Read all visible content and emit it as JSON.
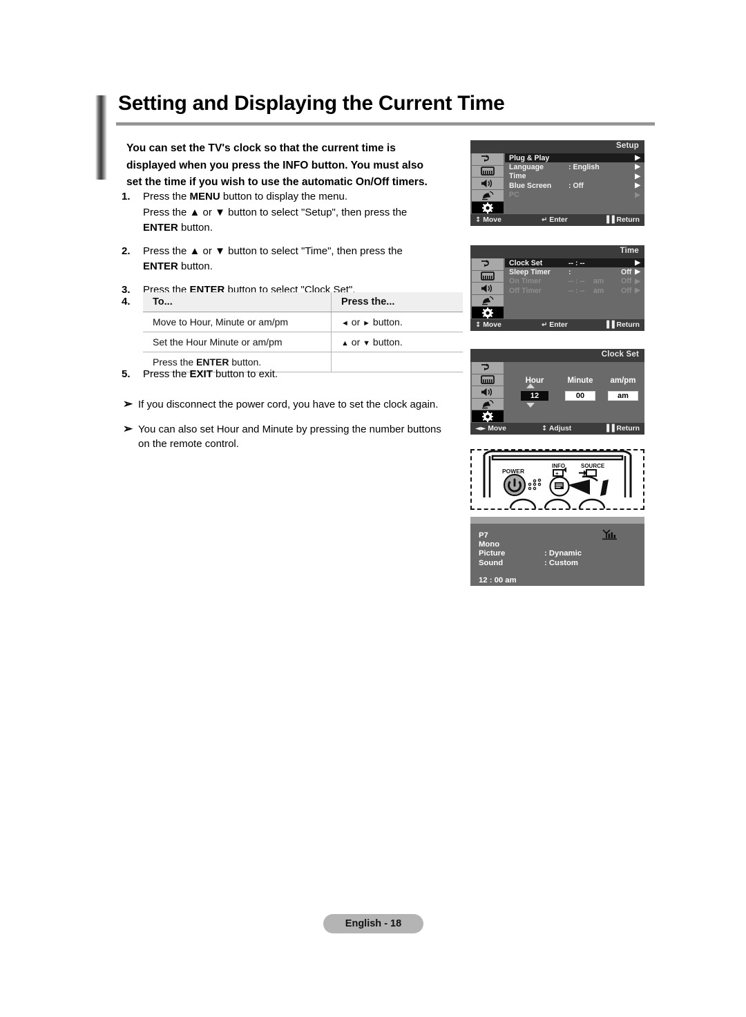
{
  "document": {
    "title": "Setting and Displaying the Current Time",
    "footer_label": "English - 18"
  },
  "intro": {
    "paragraph": "You can set the TV's clock so that the current time is displayed when you press the INFO button. You must also set the time if you wish to use the automatic On/Off timers."
  },
  "steps": [
    {
      "number": "1.",
      "line1_a": "Press the ",
      "line1_b": "MENU",
      "line1_c": " button to display the menu.",
      "line2_a": "Press the ",
      "line2_b": "▲",
      "line2_c": " or ",
      "line2_d": "▼",
      "line2_e": " button to select \"Setup\", then press the",
      "line3_b": "ENTER",
      "line3_c": " button."
    },
    {
      "number": "2.",
      "line1_a": "Press the ",
      "line1_b": "▲",
      "line1_c": " or ",
      "line1_d": "▼",
      "line1_e": " button to select \"Time\", then press the",
      "line2_b": "ENTER",
      "line2_c": " button."
    },
    {
      "number": "3.",
      "line1_a": "Press the ",
      "line1_b": "ENTER",
      "line1_c": " button to select \"Clock Set\"."
    }
  ],
  "table": {
    "step_number": "4.",
    "headers": [
      "To...",
      "Press the..."
    ],
    "rows": [
      {
        "to": "Move to Hour, Minute or am/pm",
        "press_left": "◄",
        "press_mid": " or ",
        "press_right": "►",
        "press_tail": " button."
      },
      {
        "to": "Set the Hour Minute or am/pm",
        "press_left": "▲",
        "press_mid": " or ",
        "press_right": "▼",
        "press_tail": " button."
      },
      {
        "to_a": "Press the ",
        "to_b": "ENTER",
        "to_c": " button.",
        "press_left": "",
        "press_mid": "",
        "press_right": "",
        "press_tail": ""
      }
    ]
  },
  "step5": {
    "number": "5.",
    "text_a": "Press the ",
    "text_b": "EXIT",
    "text_c": " button to exit."
  },
  "notes": [
    {
      "marker": "➢",
      "text": "If you disconnect the power cord, you have to set the clock again."
    },
    {
      "marker": "➢",
      "text": "You can also set Hour and Minute by pressing the number buttons on the remote control."
    }
  ],
  "osd_panels": [
    {
      "title": "Setup",
      "icons": [
        "input-source-icon",
        "picture-icon",
        "speaker-icon",
        "satellite-dish-icon",
        "gear-icon"
      ],
      "selected_icon_index": 4,
      "rows": [
        {
          "label": "Plug & Play",
          "value": "",
          "value2": "",
          "value3": "",
          "arrow": "▶",
          "state": "highlight"
        },
        {
          "label": "Language",
          "value": ": English",
          "value2": "",
          "value3": "",
          "arrow": "▶",
          "state": "normal"
        },
        {
          "label": "Time",
          "value": "",
          "value2": "",
          "value3": "",
          "arrow": "▶",
          "state": "normal"
        },
        {
          "label": "Blue Screen",
          "value": ": Off",
          "value2": "",
          "value3": "",
          "arrow": "▶",
          "state": "normal"
        },
        {
          "label": "PC",
          "value": "",
          "value2": "",
          "value3": "",
          "arrow": "▶",
          "state": "dim"
        }
      ],
      "footer": {
        "move": "Move",
        "enter": "Enter",
        "return": "Return",
        "move_icon": "↕",
        "enter_icon": "↵",
        "return_icon": "▐▐"
      }
    },
    {
      "title": "Time",
      "icons": [
        "input-source-icon",
        "picture-icon",
        "speaker-icon",
        "satellite-dish-icon",
        "gear-icon"
      ],
      "selected_icon_index": 4,
      "rows": [
        {
          "label": "Clock Set",
          "value": "-- : --",
          "value2": "",
          "value3": "",
          "arrow": "▶",
          "state": "highlight"
        },
        {
          "label": "Sleep Timer",
          "value": ":",
          "value2": "",
          "value3": "Off",
          "arrow": "▶",
          "state": "normal"
        },
        {
          "label": "On Timer",
          "value": "-- : --",
          "value2": "am",
          "value3": "Off",
          "arrow": "▶",
          "state": "dim"
        },
        {
          "label": "Off Timer",
          "value": "-- : --",
          "value2": "am",
          "value3": "Off",
          "arrow": "▶",
          "state": "dim"
        }
      ],
      "footer": {
        "move": "Move",
        "enter": "Enter",
        "return": "Return",
        "move_icon": "↕",
        "enter_icon": "↵",
        "return_icon": "▐▐"
      }
    }
  ],
  "clock_set_panel": {
    "title": "Clock Set",
    "icons": [
      "input-source-icon",
      "picture-icon",
      "speaker-icon",
      "satellite-dish-icon",
      "gear-icon"
    ],
    "selected_icon_index": 4,
    "field_labels": {
      "hour": "Hour",
      "minute": "Minute",
      "ampm": "am/pm"
    },
    "field_values": {
      "hour": "12",
      "minute": "00",
      "ampm": "am"
    },
    "footer": {
      "move": "Move",
      "adjust": "Adjust",
      "return": "Return",
      "move_icon": "◄►",
      "adjust_icon": "↕",
      "return_icon": "▐▐"
    }
  },
  "remote": {
    "power_label": "POWER",
    "info_label": "INFO",
    "source_label": "SOURCE"
  },
  "info_banner": {
    "channel": "P7",
    "audio": "Mono",
    "picture_key": "Picture",
    "picture_value": ": Dynamic",
    "sound_key": "Sound",
    "sound_value": ": Custom",
    "time": "12 : 00 am",
    "signal_icon": "signal-strength-icon"
  },
  "colors": {
    "osd_body": "#6a6a6a",
    "osd_header": "#3c3c3c",
    "osd_icon_bg": "#a8a8a8",
    "highlight": "#1b1b1b",
    "dim_text": "#8e8e8e",
    "footer_pill": "#b4b4b4"
  }
}
